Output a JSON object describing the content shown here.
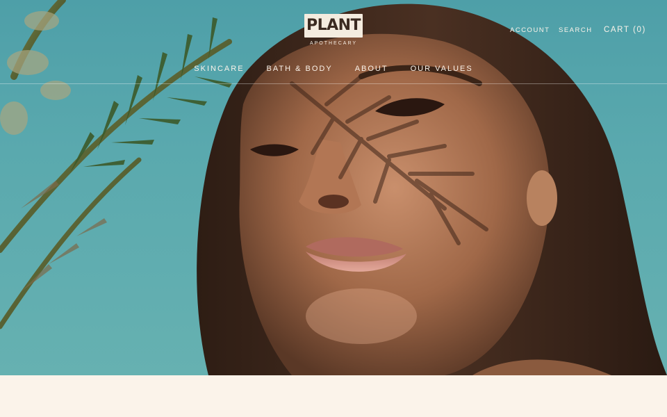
{
  "brand": {
    "logo_text": "PLANT",
    "logo_subtext": "APOTHECARY"
  },
  "header": {
    "account_label": "ACCOUNT",
    "search_label": "SEARCH",
    "cart_label": "CART (0)"
  },
  "nav": {
    "items": [
      {
        "label": "SKINCARE"
      },
      {
        "label": "BATH & BODY"
      },
      {
        "label": "ABOUT"
      },
      {
        "label": "OUR VALUES"
      }
    ]
  },
  "colors": {
    "sky": "#5aa9ae",
    "cream": "#fbf3ea",
    "logo_bg": "#f4ecdf",
    "logo_text": "#3a2a20"
  }
}
